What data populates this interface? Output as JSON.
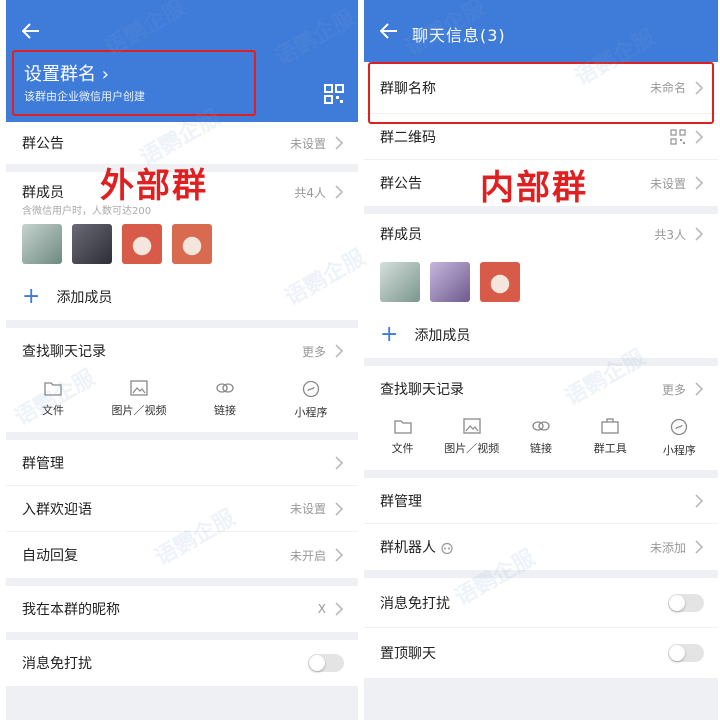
{
  "left": {
    "header": {
      "group_name_label": "设置群名 ›",
      "group_name_sub": "该群由企业微信用户创建"
    },
    "announcement": {
      "label": "群公告",
      "value": "未设置"
    },
    "members": {
      "label": "群成员",
      "sub": "含微信用户时，人数可达200",
      "count": "共4人",
      "avatars": [
        {
          "icon": "avatar-plant",
          "color": "#7f9a8e"
        },
        {
          "icon": "avatar-anime",
          "color": "#4a4a56"
        },
        {
          "icon": "avatar-doll",
          "color": "#d85a48"
        },
        {
          "icon": "avatar-doll",
          "color": "#d86a50"
        }
      ]
    },
    "add_member": "添加成员",
    "search_history": {
      "label": "查找聊天记录",
      "value": "更多"
    },
    "tools": [
      {
        "label": "文件",
        "icon": "folder-icon"
      },
      {
        "label": "图片／视频",
        "icon": "image-icon"
      },
      {
        "label": "链接",
        "icon": "link-icon"
      },
      {
        "label": "小程序",
        "icon": "miniprogram-icon"
      }
    ],
    "group_manage": {
      "label": "群管理"
    },
    "welcome": {
      "label": "入群欢迎语",
      "value": "未设置"
    },
    "auto_reply": {
      "label": "自动回复",
      "value": "未开启"
    },
    "nickname": {
      "label": "我在本群的昵称",
      "value": "X"
    },
    "dnd_partial": "消息免打扰",
    "annotation": "外部群"
  },
  "right": {
    "header": {
      "title": "聊天信息(3)"
    },
    "group_name": {
      "label": "群聊名称",
      "value": "未命名"
    },
    "qr": {
      "label": "群二维码"
    },
    "announcement": {
      "label": "群公告",
      "value": "未设置"
    },
    "members": {
      "label": "群成员",
      "count": "共3人",
      "avatars": [
        {
          "icon": "avatar-plant",
          "color": "#8aa39a"
        },
        {
          "icon": "avatar-flower",
          "color": "#9a86b8"
        },
        {
          "icon": "avatar-doll",
          "color": "#d85a48"
        }
      ]
    },
    "add_member": "添加成员",
    "search_history": {
      "label": "查找聊天记录",
      "value": "更多"
    },
    "tools": [
      {
        "label": "文件",
        "icon": "folder-icon"
      },
      {
        "label": "图片／视频",
        "icon": "image-icon"
      },
      {
        "label": "链接",
        "icon": "link-icon"
      },
      {
        "label": "群工具",
        "icon": "toolbox-icon"
      },
      {
        "label": "小程序",
        "icon": "miniprogram-icon"
      }
    ],
    "group_manage": {
      "label": "群管理"
    },
    "robot": {
      "label": "群机器人",
      "value": "未添加"
    },
    "dnd": {
      "label": "消息免打扰"
    },
    "pin": {
      "label": "置顶聊天"
    },
    "annotation": "内部群"
  },
  "watermark": "语鹦企服",
  "colors": {
    "header": "#3f7bd8",
    "annotation": "#e02020"
  }
}
